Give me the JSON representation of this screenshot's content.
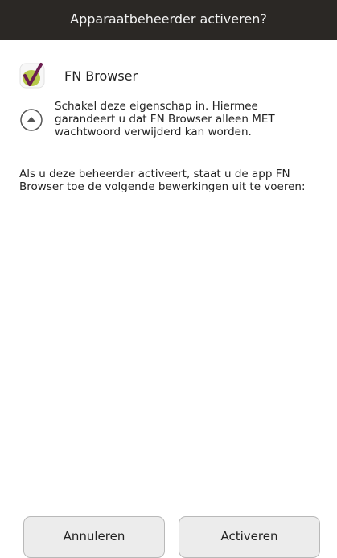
{
  "dialog": {
    "title": "Apparaatbeheerder activeren?"
  },
  "app": {
    "name": "FN Browser",
    "icon": "fn-browser-checkmark-icon"
  },
  "description": {
    "icon": "expand-up-icon",
    "text": "Schakel deze eigenschap in. Hiermee garandeert u dat FN Browser alleen MET wachtwoord verwijderd kan worden."
  },
  "warning": {
    "text": "Als u deze beheerder activeert, staat u de app FN Browser toe de volgende bewerkingen uit te voeren:"
  },
  "buttons": {
    "cancel": "Annuleren",
    "activate": "Activeren"
  },
  "colors": {
    "title_bar": "#2b2825",
    "app_icon_green": "#b7c94a",
    "app_icon_check": "#6b1d4f"
  }
}
